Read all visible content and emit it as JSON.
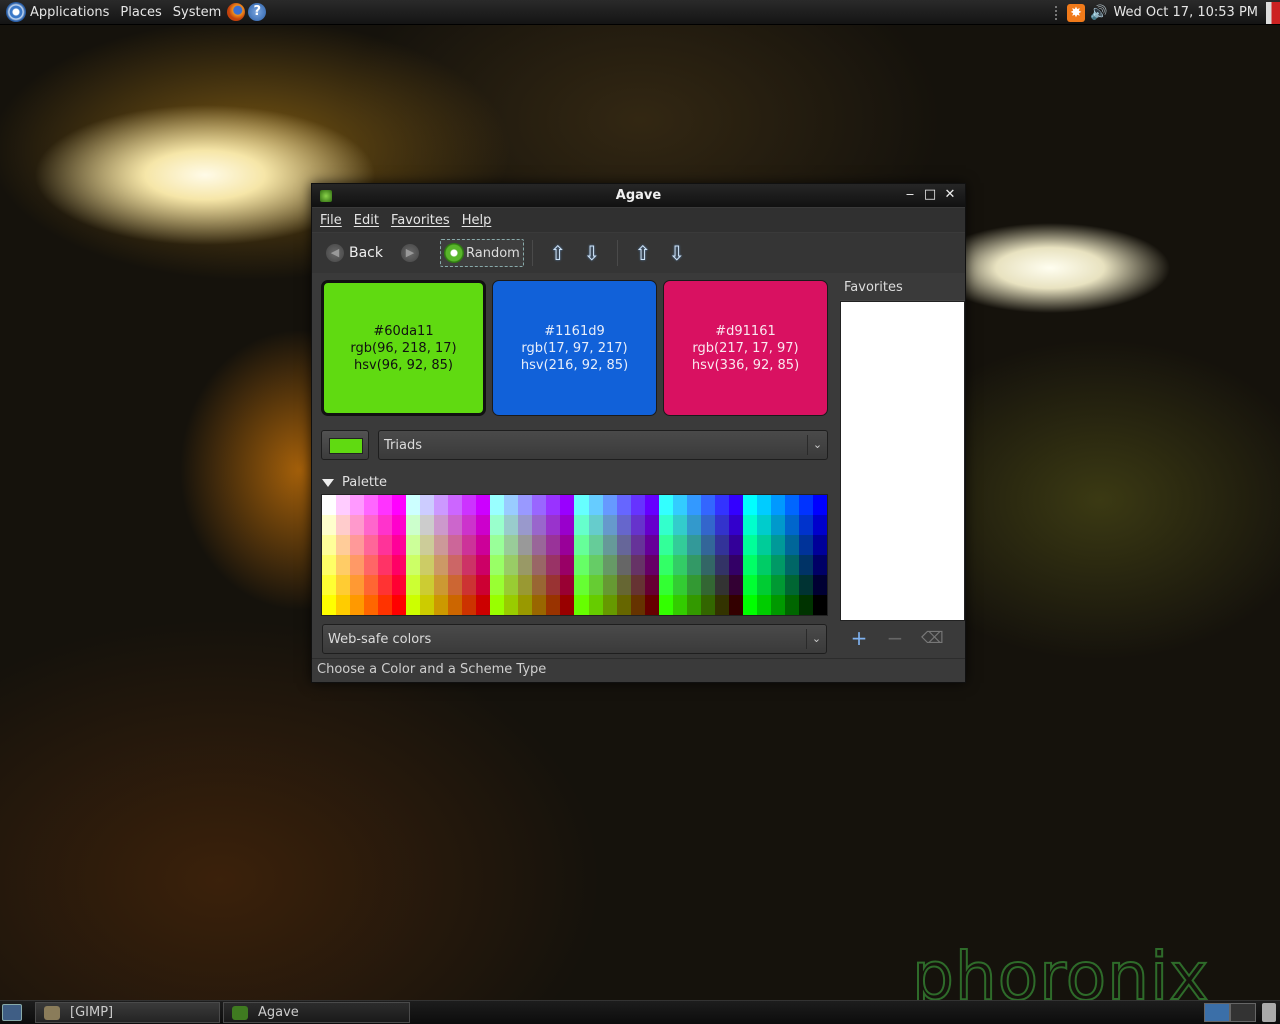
{
  "top_panel": {
    "menus": [
      "Applications",
      "Places",
      "System"
    ],
    "clock": "Wed Oct 17, 10:53 PM"
  },
  "window": {
    "title": "Agave",
    "menu": [
      "File",
      "Edit",
      "Favorites",
      "Help"
    ],
    "toolbar": {
      "back_label": "Back",
      "random_label": "Random"
    },
    "swatches": [
      {
        "hex": "#60da11",
        "rgb": "rgb(96, 218, 17)",
        "hsv": "hsv(96, 92, 85)",
        "color": "#60da11",
        "text_color": "#111111"
      },
      {
        "hex": "#1161d9",
        "rgb": "rgb(17, 97, 217)",
        "hsv": "hsv(216, 92, 85)",
        "color": "#1161d9",
        "text_color": "#e8eefa"
      },
      {
        "hex": "#d91161",
        "rgb": "rgb(217, 17, 97)",
        "hsv": "hsv(336, 92, 85)",
        "color": "#d91161",
        "text_color": "#fae8ef"
      }
    ],
    "scheme_type": "Triads",
    "palette_label": "Palette",
    "palette_name": "Web-safe colors",
    "favorites_label": "Favorites",
    "status": "Choose a Color and a Scheme Type"
  },
  "taskbar": {
    "tasks": [
      "[GIMP]",
      "Agave"
    ]
  },
  "watermark": "phoronix"
}
